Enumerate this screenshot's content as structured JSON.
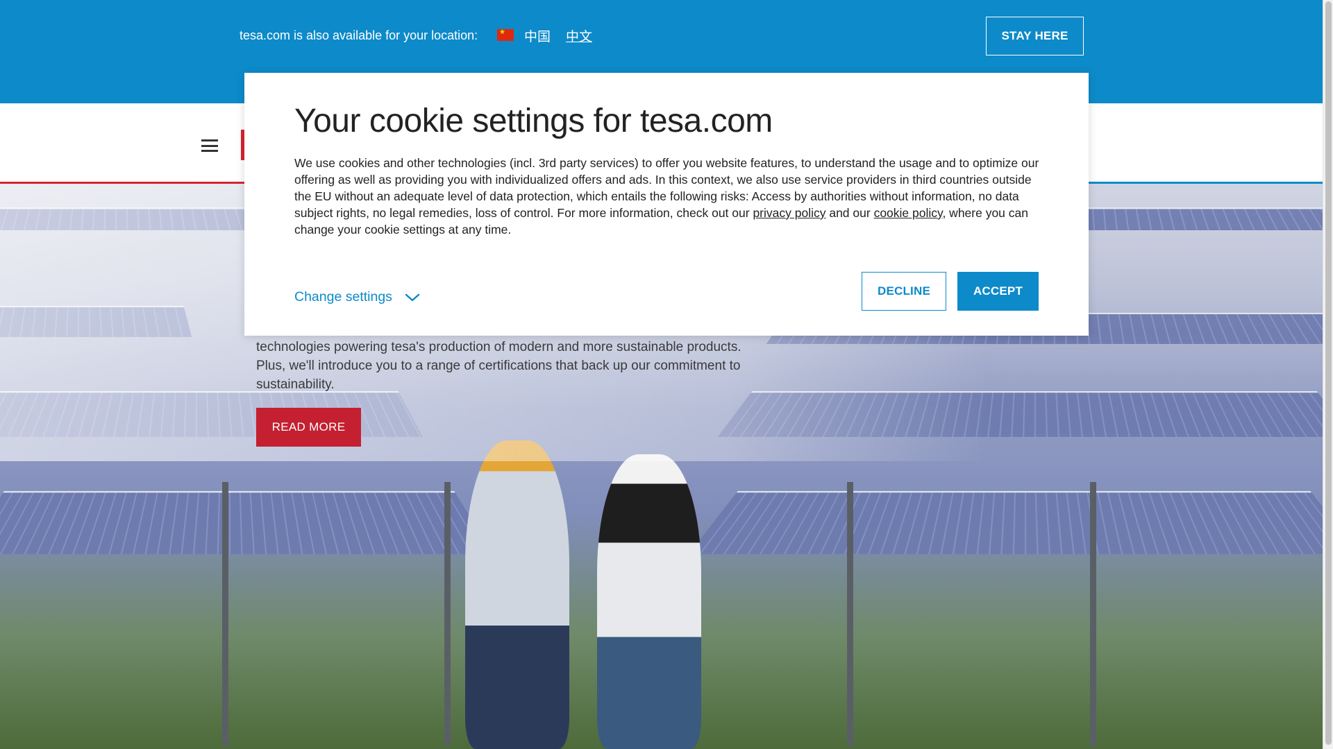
{
  "location_bar": {
    "message": "tesa.com is also available for your location:",
    "country": "中国",
    "language_link": "中文",
    "stay_button": "STAY HERE"
  },
  "hero": {
    "body_lines": [
      "technologies powering tesa's production of modern and more sustainable products.",
      "Plus, we'll introduce you to a range of certifications that back up our commitment to",
      "sustainability."
    ],
    "read_more": "READ MORE"
  },
  "cookie": {
    "title": "Your cookie settings for tesa.com",
    "body_pre": "We use cookies and other technologies (incl. 3rd party services) to offer you website features, to understand the usage and to optimize our offering as well as providing you with individualized offers and ads. In this context, we also use service providers in third countries outside the EU without an adequate level of data protection, which entails the following risks: Access by authorities without information, no data subject rights, no legal remedies, loss of control. For more information, check out our ",
    "privacy_link": "privacy policy",
    "between_links": " and our ",
    "cookie_link": "cookie policy",
    "body_post": ", where you can change your cookie settings at any time.",
    "change_settings": "Change settings",
    "decline": "DECLINE",
    "accept": "ACCEPT"
  },
  "colors": {
    "brand_blue": "#0d8ac9",
    "brand_red": "#c42031"
  }
}
